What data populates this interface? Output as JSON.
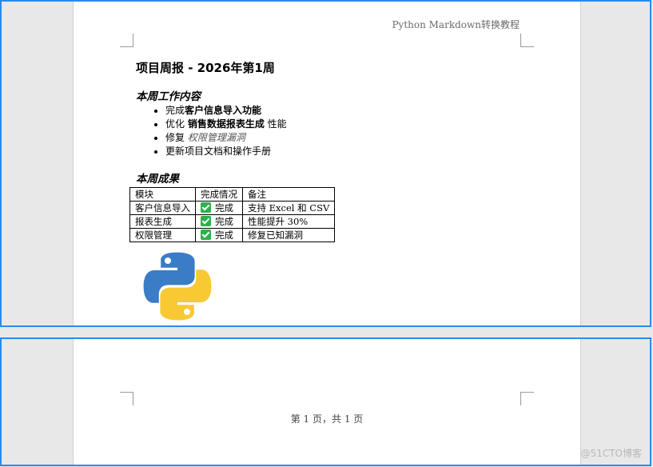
{
  "header": {
    "text": "Python Markdown转换教程"
  },
  "document": {
    "title": "项目周报 - 2026年第1周",
    "work_heading": "本周工作内容",
    "tasks": [
      {
        "prefix": "完成",
        "bold": "客户信息导入功能",
        "suffix": ""
      },
      {
        "prefix": "优化 ",
        "bold": "销售数据报表生成",
        "suffix": " 性能"
      },
      {
        "prefix": "修复 ",
        "italic": "权限管理漏洞"
      },
      {
        "prefix": "更新项目文档和操作手册"
      }
    ],
    "results_heading": "本周成果",
    "table": {
      "headers": [
        "模块",
        "完成情况",
        "备注"
      ],
      "rows": [
        [
          "客户信息导入",
          "完成",
          "支持 Excel 和 CSV"
        ],
        [
          "报表生成",
          "完成",
          "性能提升 30%"
        ],
        [
          "权限管理",
          "完成",
          "修复已知漏洞"
        ]
      ]
    }
  },
  "footer": {
    "text": "第 1 页，共 1 页"
  },
  "icons": {
    "status": "check-icon",
    "image": "python-logo-icon"
  },
  "colors": {
    "frame": "#2e8ae6",
    "check": "#2db14b",
    "python_blue": "#3b7cc6",
    "python_yellow": "#f8c933"
  },
  "watermark": "@51CTO博客"
}
